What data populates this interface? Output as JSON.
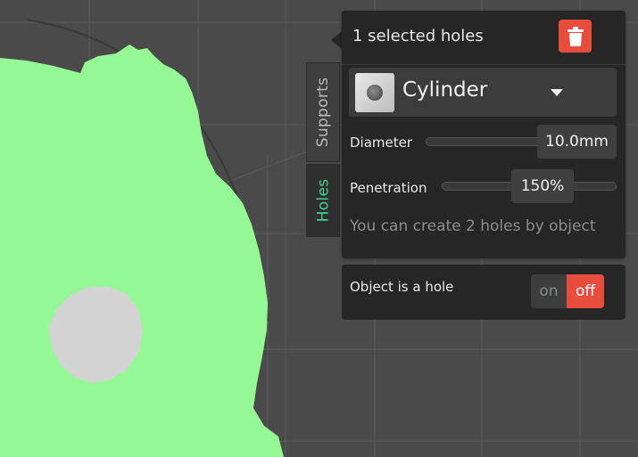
{
  "sidebar": {
    "tabs": [
      {
        "label": "Supports",
        "active": false
      },
      {
        "label": "Holes",
        "active": true
      }
    ]
  },
  "panel": {
    "title": "1 selected holes",
    "delete_icon": "trash-icon",
    "shape": {
      "label": "Cylinder",
      "icon": "cylinder-thumbnail"
    },
    "diameter": {
      "label": "Diameter",
      "value": "10.0mm"
    },
    "penetration": {
      "label": "Penetration",
      "value": "150%"
    },
    "info": "You can create 2 holes by object"
  },
  "hole_toggle": {
    "label": "Object is a hole",
    "on_label": "on",
    "off_label": "off",
    "state": "off"
  },
  "colors": {
    "background": "#4a4a4a",
    "model": "#94f894",
    "hole": "#d3d3d3",
    "accent_green": "#3fd28e",
    "danger": "#e84c3d",
    "panel": "#262626"
  }
}
